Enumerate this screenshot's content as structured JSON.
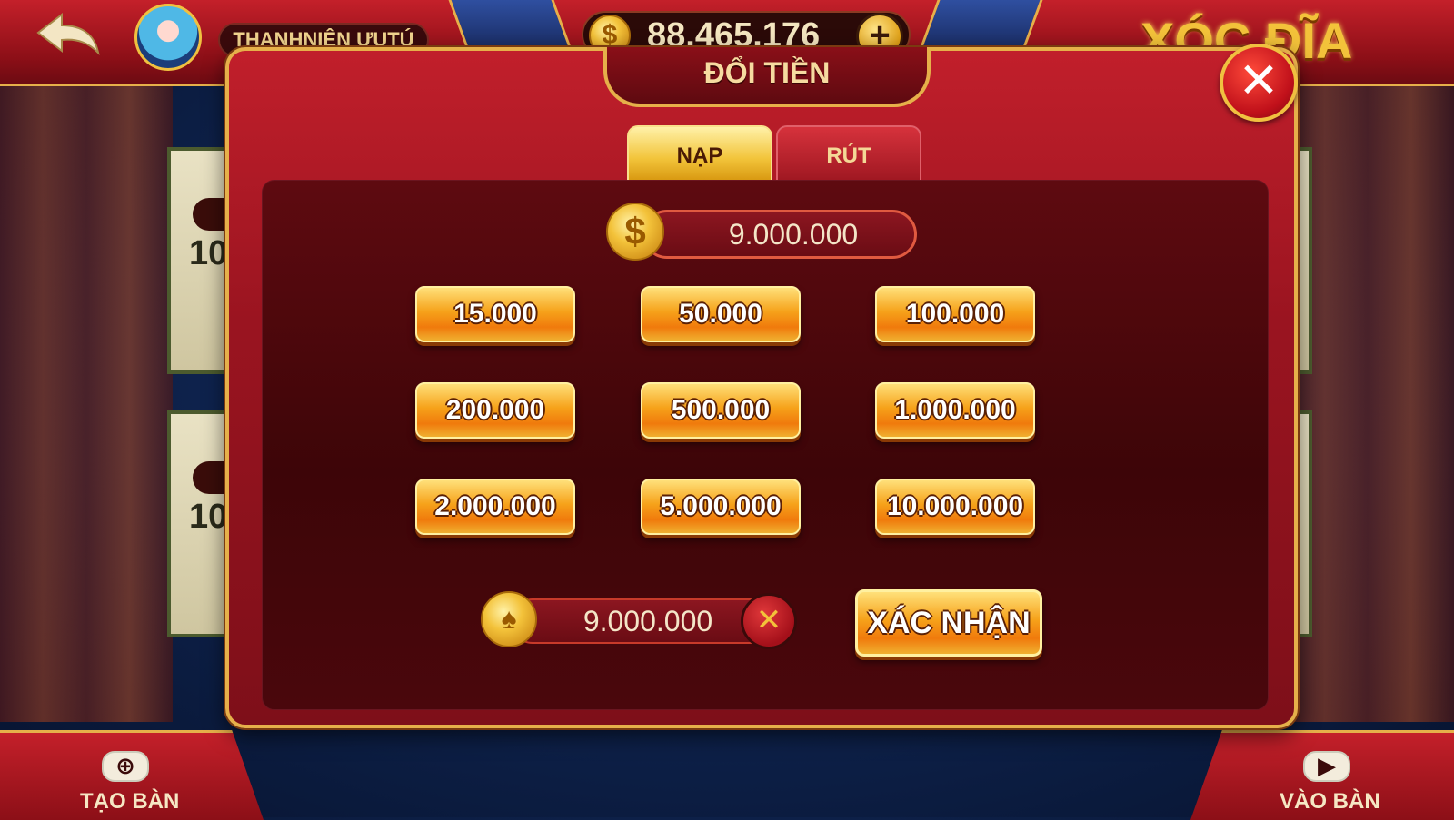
{
  "header": {
    "username": "THANHNIÊN ƯUTÚ",
    "balance": "88.465.176",
    "plus_symbol": "+",
    "game_title": "XÓC ĐĨA",
    "back_icon": "back-arrow-icon",
    "avatar_icon": "avatar-icon"
  },
  "background": {
    "table_badge_number": "10"
  },
  "modal": {
    "title": "ĐỔI TIỀN",
    "close_symbol": "✕",
    "tabs": [
      {
        "label": "NẠP",
        "active": true
      },
      {
        "label": "RÚT",
        "active": false
      }
    ],
    "amount_display": "9.000.000",
    "coin_symbol": "$",
    "denominations": [
      "15.000",
      "50.000",
      "100.000",
      "200.000",
      "500.000",
      "1.000.000",
      "2.000.000",
      "5.000.000",
      "10.000.000"
    ],
    "selected_amount": "9.000.000",
    "selected_coin_symbol": "♠",
    "clear_symbol": "✕",
    "confirm_label": "XÁC NHẬN"
  },
  "footer": {
    "create_table": {
      "label": "TẠO BÀN",
      "icon": "plus-circle-icon",
      "symbol": "⊕"
    },
    "join_table": {
      "label": "VÀO BÀN",
      "icon": "play-circle-icon",
      "symbol": "▶"
    }
  },
  "colors": {
    "primary_red": "#c4202a",
    "gold": "#e6b04a",
    "button_orange": "#f6a21a",
    "background_blue": "#0f2450"
  }
}
